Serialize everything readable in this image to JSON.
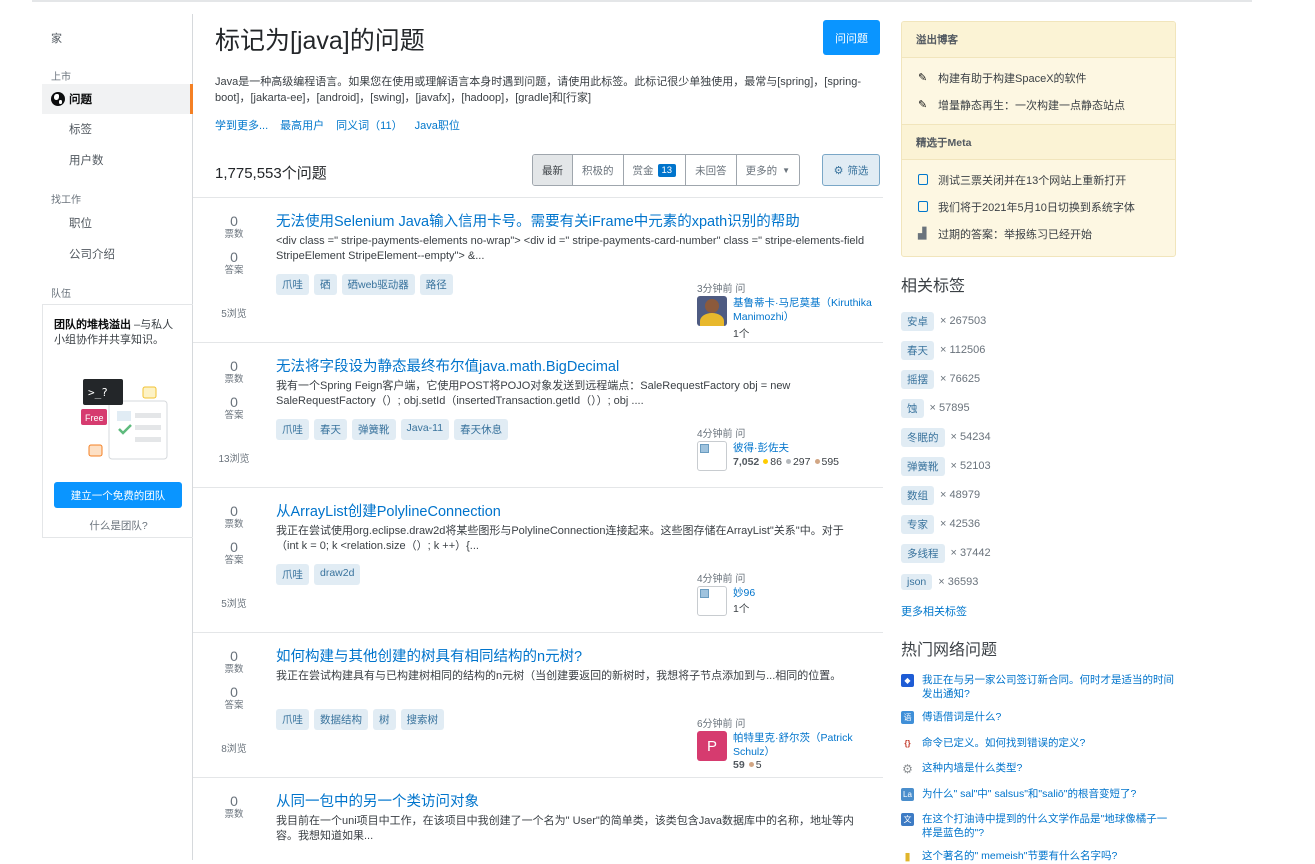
{
  "left_nav": {
    "home": "家",
    "section_public": "上市",
    "questions": "问题",
    "tags": "标签",
    "users": "用户数",
    "section_jobs": "找工作",
    "jobs": "职位",
    "companies": "公司介绍",
    "section_teams": "队伍",
    "teams_title": "团队的堆栈溢出",
    "teams_text": " –与私人小组协作并共享知识。",
    "teams_free": "Free",
    "teams_prompt": ">_?",
    "teams_button": "建立一个免费的团队",
    "teams_what": "什么是团队?"
  },
  "header": {
    "title": "标记为[java]的问题",
    "ask_button": "问问题",
    "description": "Java是一种高级编程语言。如果您在使用或理解语言本身时遇到问题，请使用此标签。此标记很少单独使用，最常与[spring]，[spring-boot]，[jakarta-ee]，[android]，[swing]，[javafx]，[hadoop]，[gradle]和[行家]",
    "links": [
      "学到更多...",
      "最高用户",
      "同义词（11）",
      "Java职位"
    ],
    "count": "1,775,553个问题",
    "filters": [
      "最新",
      "积极的",
      "赏金",
      "未回答",
      "更多的"
    ],
    "bounty_count": "13",
    "filter_button": "筛选"
  },
  "questions": [
    {
      "votes": "0",
      "votes_label": "票数",
      "answers": "0",
      "answers_label": "答案",
      "views": "5浏览",
      "title": "无法使用Selenium Java输入信用卡号。需要有关iFrame中元素的xpath识别的帮助",
      "excerpt": "<div class =\" stripe-payments-elements no-wrap\"> <div id =\" stripe-payments-card-number\" class =\" stripe-elements-field StripeElement StripeElement--empty\"> &...",
      "tags": [
        "爪哇",
        "硒",
        "硒web驱动器",
        "路径"
      ],
      "asked": "3分钟前 问",
      "user": "基鲁蒂卡·马尼莫基（Kiruthika Manimozhi）",
      "rep": "1个",
      "gold": "",
      "silver": "",
      "bronze": ""
    },
    {
      "votes": "0",
      "votes_label": "票数",
      "answers": "0",
      "answers_label": "答案",
      "views": "13浏览",
      "title": "无法将字段设为静态最终布尔值java.math.BigDecimal",
      "excerpt": "我有一个Spring Feign客户端，它使用POST将POJO对象发送到远程端点：SaleRequestFactory obj = new SaleRequestFactory（）; obj.setId（insertedTransaction.getId（））; obj ....",
      "tags": [
        "爪哇",
        "春天",
        "弹簧靴",
        "Java-11",
        "春天休息"
      ],
      "asked": "4分钟前 问",
      "user": "彼得·彭佐夫",
      "rep": "7,052",
      "gold": "86",
      "silver": "297",
      "bronze": "595"
    },
    {
      "votes": "0",
      "votes_label": "票数",
      "answers": "0",
      "answers_label": "答案",
      "views": "5浏览",
      "title": "从ArrayList创建PolylineConnection",
      "excerpt": "我正在尝试使用org.eclipse.draw2d将某些图形与PolylineConnection连接起来。这些图存储在ArrayList\"关系\"中。对于（int k = 0; k <relation.size（）; k ++）{...",
      "tags": [
        "爪哇",
        "draw2d"
      ],
      "asked": "4分钟前 问",
      "user": "妙96",
      "rep": "1个",
      "gold": "",
      "silver": "",
      "bronze": ""
    },
    {
      "votes": "0",
      "votes_label": "票数",
      "answers": "0",
      "answers_label": "答案",
      "views": "8浏览",
      "title": "如何构建与其他创建的树具有相同结构的n元树?",
      "excerpt": "我正在尝试构建具有与已构建树相同的结构的n元树（当创建要返回的新树时，我想将子节点添加到与...相同的位置。",
      "tags": [
        "爪哇",
        "数据结构",
        "树",
        "搜索树"
      ],
      "asked": "6分钟前 问",
      "user": "帕特里克·舒尔茨（Patrick Schulz）",
      "avatar_letter": "P",
      "rep": "59",
      "gold": "",
      "silver": "",
      "bronze": "5"
    },
    {
      "votes": "0",
      "votes_label": "票数",
      "answers": "",
      "answers_label": "",
      "views": "",
      "title": "从同一包中的另一个类访问对象",
      "excerpt": "我目前在一个uni项目中工作，在该项目中我创建了一个名为\" User\"的简单类，该类包含Java数据库中的名称，地址等内容。我想知道如果...",
      "tags": [],
      "asked": "",
      "user": "",
      "rep": "",
      "gold": "",
      "silver": "",
      "bronze": ""
    }
  ],
  "blog": {
    "header": "溢出博客",
    "items": [
      "构建有助于构建SpaceX的软件",
      "增量静态再生：一次构建一点静态站点"
    ],
    "meta_header": "精选于Meta",
    "meta_items": [
      "测试三票关闭并在13个网站上重新打开",
      "我们将于2021年5月10日切换到系统字体",
      "过期的答案：举报练习已经开始"
    ]
  },
  "related": {
    "title": "相关标签",
    "tags": [
      {
        "name": "安卓",
        "count": "× 267503"
      },
      {
        "name": "春天",
        "count": "× 112506"
      },
      {
        "name": "摇摆",
        "count": "× 76625"
      },
      {
        "name": "蚀",
        "count": "× 57895"
      },
      {
        "name": "冬眠的",
        "count": "× 54234"
      },
      {
        "name": "弹簧靴",
        "count": "× 52103"
      },
      {
        "name": "数组",
        "count": "× 48979"
      },
      {
        "name": "专家",
        "count": "× 42536"
      },
      {
        "name": "多线程",
        "count": "× 37442"
      },
      {
        "name": "json",
        "count": "× 36593"
      }
    ],
    "more": "更多相关标签"
  },
  "hot": {
    "title": "热门网络问题",
    "items": [
      {
        "text": "我正在与另一家公司签订新合同。何时才是适当的时间发出通知?",
        "color": "#1e5cd5",
        "glyph": "◆"
      },
      {
        "text": "傅语借词是什么?",
        "color": "#3f8fd8",
        "glyph": "语"
      },
      {
        "text": "命令已定义。如何找到错误的定义?",
        "color": "#c23728",
        "glyph": "{}"
      },
      {
        "text": "这种内墙是什么类型?",
        "color": "#8b8f92",
        "glyph": "⚙"
      },
      {
        "text": "为什么\" sal\"中\" salsus\"和\"saliō\"的根音变短了?",
        "color": "#4a8ecc",
        "glyph": "La"
      },
      {
        "text": "在这个打油诗中提到的什么文学作品是\"地球像橘子一样是蓝色的\"?",
        "color": "#3d7bc4",
        "glyph": "文"
      },
      {
        "text": "这个著名的\" memeish\"节要有什么名字吗?",
        "color": "#e0b52b",
        "glyph": "▮"
      }
    ]
  },
  "colors": {
    "accent": "#f48024",
    "link": "#0074cc",
    "button": "#0a95ff",
    "tag_bg": "#e1ecf4",
    "tag_fg": "#39739d",
    "blog_bg": "#fdf7e2"
  },
  "icons": {
    "questions": "globe-icon",
    "blog_item": "pencil-icon",
    "meta_item": "checkbox-icon",
    "meta_item_3": "podium-icon",
    "filter": "gear-icon"
  }
}
